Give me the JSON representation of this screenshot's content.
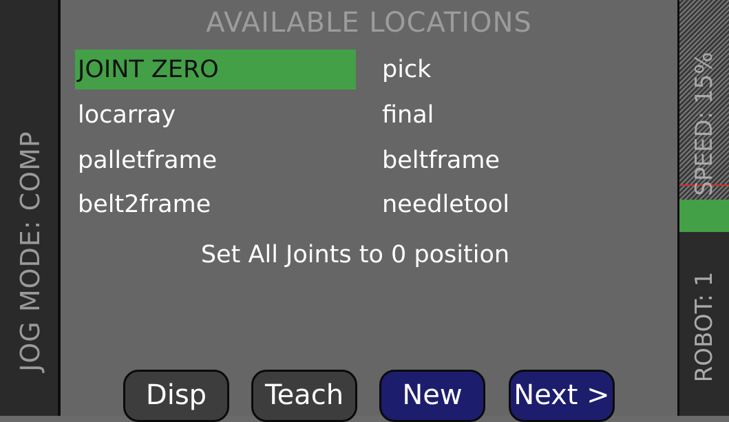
{
  "left_band": {
    "jog_mode": "JOG MODE: COMP"
  },
  "title": "AVAILABLE LOCATIONS",
  "locations": [
    {
      "label": "JOINT ZERO",
      "selected": true
    },
    {
      "label": "pick"
    },
    {
      "label": "locarray"
    },
    {
      "label": "final"
    },
    {
      "label": "palletframe"
    },
    {
      "label": "beltframe"
    },
    {
      "label": "belt2frame"
    },
    {
      "label": "needletool"
    }
  ],
  "description": "Set All Joints to 0 position",
  "buttons": {
    "disp": "Disp",
    "teach": "Teach",
    "new": "New",
    "next": "Next >"
  },
  "right_band": {
    "speed": "SPEED: 15%",
    "robot": "ROBOT: 1"
  },
  "colors": {
    "selected_green": "#43a047",
    "navy_button": "#1d1d6e",
    "speed_marker_red": "#d23030"
  }
}
